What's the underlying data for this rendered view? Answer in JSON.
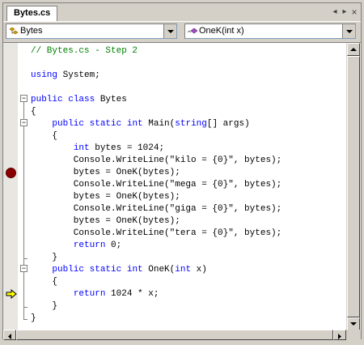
{
  "tab": {
    "title": "Bytes.cs"
  },
  "tab_controls": {
    "prev": "◂",
    "next": "▸",
    "close": "×"
  },
  "nav": {
    "class_combo": "Bytes",
    "member_combo": "OneK(int x)"
  },
  "code_lines": [
    {
      "parts": [
        {
          "t": "// Bytes.cs - Step 2",
          "c": "cm"
        }
      ]
    },
    {
      "parts": []
    },
    {
      "parts": [
        {
          "t": "using",
          "c": "kw"
        },
        {
          "t": " System;"
        }
      ]
    },
    {
      "parts": []
    },
    {
      "parts": [
        {
          "t": "public",
          "c": "kw"
        },
        {
          "t": " "
        },
        {
          "t": "class",
          "c": "kw"
        },
        {
          "t": " Bytes"
        }
      ]
    },
    {
      "parts": [
        {
          "t": "{"
        }
      ]
    },
    {
      "parts": [
        {
          "t": "    "
        },
        {
          "t": "public",
          "c": "kw"
        },
        {
          "t": " "
        },
        {
          "t": "static",
          "c": "kw"
        },
        {
          "t": " "
        },
        {
          "t": "int",
          "c": "kw"
        },
        {
          "t": " Main("
        },
        {
          "t": "string",
          "c": "kw"
        },
        {
          "t": "[] args)"
        }
      ]
    },
    {
      "parts": [
        {
          "t": "    {"
        }
      ]
    },
    {
      "parts": [
        {
          "t": "        "
        },
        {
          "t": "int",
          "c": "kw"
        },
        {
          "t": " bytes = 1024;"
        }
      ]
    },
    {
      "parts": [
        {
          "t": "        Console.WriteLine(\"kilo = {0}\", bytes);"
        }
      ]
    },
    {
      "parts": [
        {
          "t": "        bytes = OneK(bytes);"
        }
      ]
    },
    {
      "parts": [
        {
          "t": "        Console.WriteLine(\"mega = {0}\", bytes);"
        }
      ]
    },
    {
      "parts": [
        {
          "t": "        bytes = OneK(bytes);"
        }
      ]
    },
    {
      "parts": [
        {
          "t": "        Console.WriteLine(\"giga = {0}\", bytes);"
        }
      ]
    },
    {
      "parts": [
        {
          "t": "        bytes = OneK(bytes);"
        }
      ]
    },
    {
      "parts": [
        {
          "t": "        Console.WriteLine(\"tera = {0}\", bytes);"
        }
      ]
    },
    {
      "parts": [
        {
          "t": "        "
        },
        {
          "t": "return",
          "c": "kw"
        },
        {
          "t": " 0;"
        }
      ]
    },
    {
      "parts": [
        {
          "t": "    }"
        }
      ]
    },
    {
      "parts": [
        {
          "t": "    "
        },
        {
          "t": "public",
          "c": "kw"
        },
        {
          "t": " "
        },
        {
          "t": "static",
          "c": "kw"
        },
        {
          "t": " "
        },
        {
          "t": "int",
          "c": "kw"
        },
        {
          "t": " OneK("
        },
        {
          "t": "int",
          "c": "kw"
        },
        {
          "t": " x)"
        }
      ]
    },
    {
      "parts": [
        {
          "t": "    {"
        }
      ]
    },
    {
      "parts": [
        {
          "t": "        "
        },
        {
          "t": "return",
          "c": "kw"
        },
        {
          "t": " 1024 * x;"
        }
      ]
    },
    {
      "parts": [
        {
          "t": "    }"
        }
      ]
    },
    {
      "parts": [
        {
          "t": "}"
        }
      ]
    }
  ],
  "breakpoint_line": 10,
  "current_line": 20,
  "colors": {
    "keyword": "#0000ff",
    "comment": "#008000",
    "breakpoint": "#8b0000",
    "instruction_pointer": "#ffff00"
  }
}
